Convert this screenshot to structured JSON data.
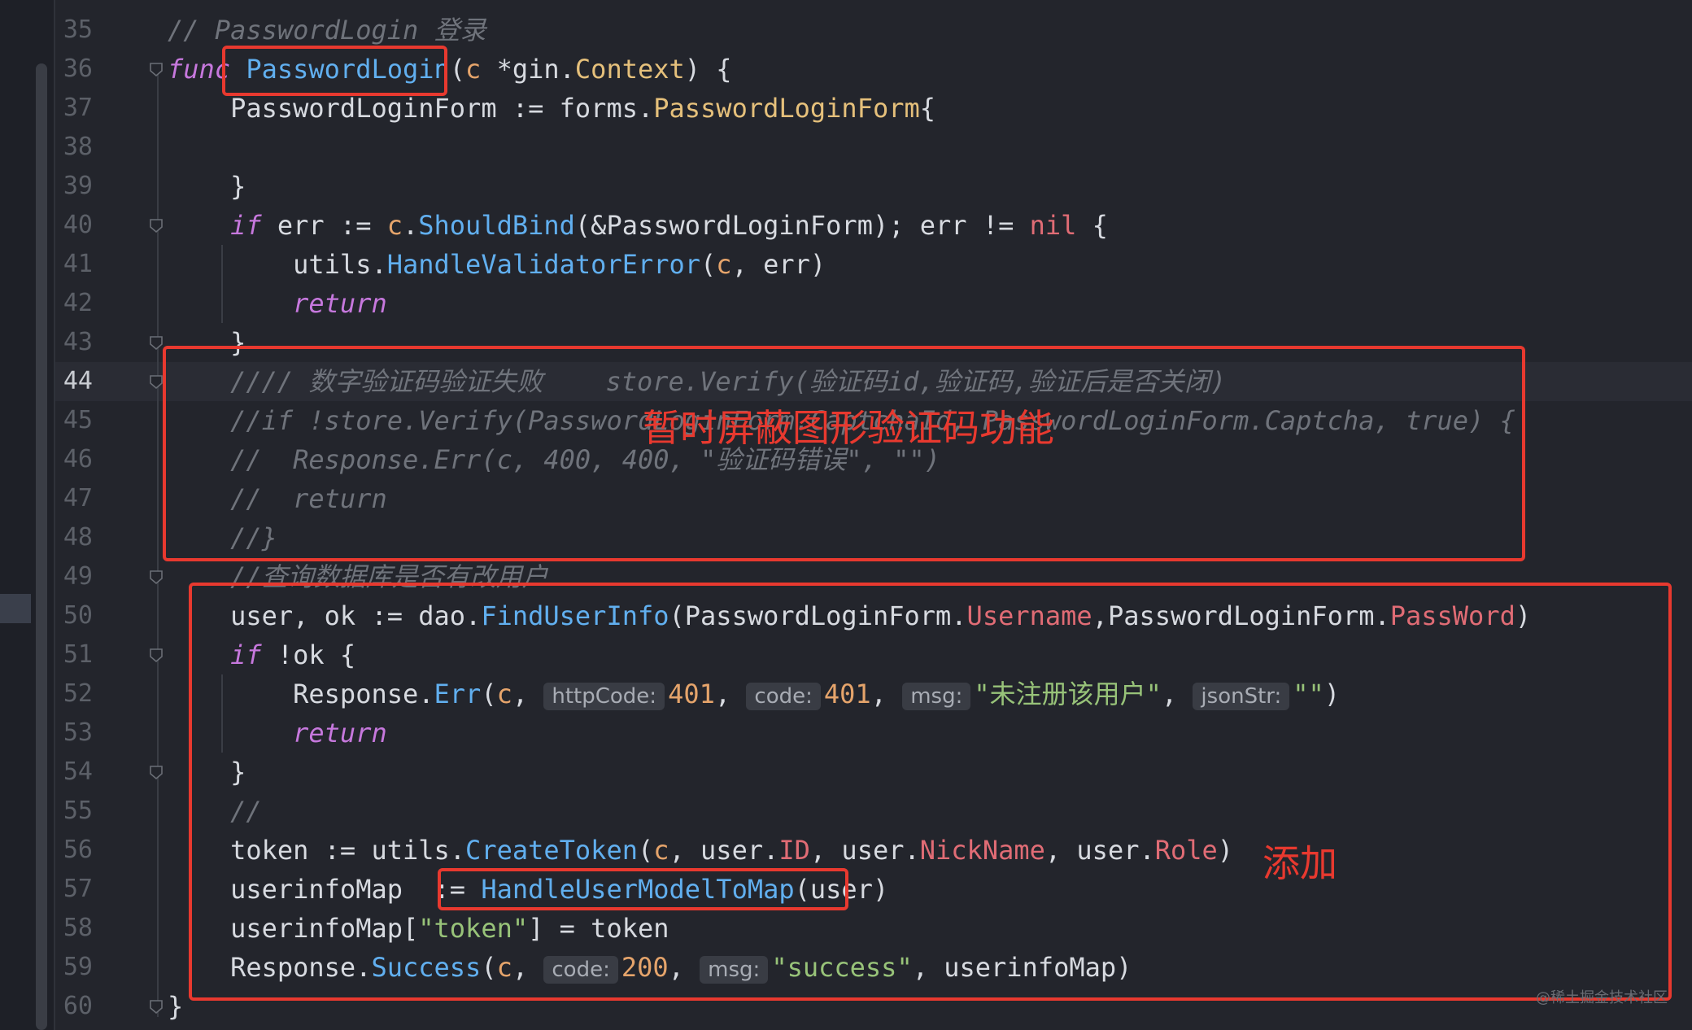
{
  "annotations": {
    "mask_captcha": "暂时屏蔽图形验证码功能",
    "added": "添加"
  },
  "watermark": "@稀土掘金技术社区",
  "colors": {
    "background": "#23252c",
    "annotation_red": "#e8392f",
    "keyword": "#c678dd",
    "function": "#61afef",
    "type": "#e5c07b",
    "field": "#e06c75",
    "string": "#98c379",
    "comment": "#6f737b"
  },
  "lines": [
    {
      "n": "35",
      "fold": false,
      "tokens": [
        {
          "t": "// PasswordLogin 登录",
          "c": "comment"
        }
      ]
    },
    {
      "n": "36",
      "fold": true,
      "tokens": [
        {
          "t": "func ",
          "c": "keyword"
        },
        {
          "t": "PasswordLogin",
          "c": "func"
        },
        {
          "t": "(",
          "c": "punct"
        },
        {
          "t": "c",
          "c": "param"
        },
        {
          "t": " *gin.",
          "c": "plain"
        },
        {
          "t": "Context",
          "c": "type"
        },
        {
          "t": ") {",
          "c": "punct"
        }
      ]
    },
    {
      "n": "37",
      "fold": false,
      "tokens": [
        {
          "t": "    PasswordLoginForm := forms.",
          "c": "plain"
        },
        {
          "t": "PasswordLoginForm",
          "c": "type"
        },
        {
          "t": "{",
          "c": "punct"
        }
      ]
    },
    {
      "n": "38",
      "fold": false,
      "tokens": []
    },
    {
      "n": "39",
      "fold": false,
      "tokens": [
        {
          "t": "    }",
          "c": "punct"
        }
      ]
    },
    {
      "n": "40",
      "fold": true,
      "tokens": [
        {
          "t": "    ",
          "c": "plain"
        },
        {
          "t": "if",
          "c": "keyword"
        },
        {
          "t": " err := ",
          "c": "plain"
        },
        {
          "t": "c",
          "c": "param"
        },
        {
          "t": ".",
          "c": "plain"
        },
        {
          "t": "ShouldBind",
          "c": "func"
        },
        {
          "t": "(&PasswordLoginForm); err != ",
          "c": "plain"
        },
        {
          "t": "nil",
          "c": "nil"
        },
        {
          "t": " {",
          "c": "punct"
        }
      ]
    },
    {
      "n": "41",
      "fold": false,
      "tokens": [
        {
          "t": "        utils.",
          "c": "plain"
        },
        {
          "t": "HandleValidatorError",
          "c": "func"
        },
        {
          "t": "(",
          "c": "punct"
        },
        {
          "t": "c",
          "c": "param"
        },
        {
          "t": ", err)",
          "c": "plain"
        }
      ]
    },
    {
      "n": "42",
      "fold": false,
      "tokens": [
        {
          "t": "        ",
          "c": "plain"
        },
        {
          "t": "return",
          "c": "keyword"
        }
      ]
    },
    {
      "n": "43",
      "fold": true,
      "tokens": [
        {
          "t": "    }",
          "c": "punct"
        }
      ]
    },
    {
      "n": "44",
      "fold": true,
      "active": true,
      "tokens": [
        {
          "t": "    //// 数字验证码验证失败    store.Verify(验证码id,验证码,验证后是否关闭)",
          "c": "comment"
        }
      ]
    },
    {
      "n": "45",
      "fold": false,
      "tokens": [
        {
          "t": "    //if !store.Verify(PasswordLoginForm.CaptchaId, PasswordLoginForm.Captcha, true) {",
          "c": "comment"
        }
      ]
    },
    {
      "n": "46",
      "fold": false,
      "tokens": [
        {
          "t": "    //  Response.Err(c, 400, 400, \"验证码错误\", \"\")",
          "c": "comment"
        }
      ]
    },
    {
      "n": "47",
      "fold": false,
      "tokens": [
        {
          "t": "    //  return",
          "c": "comment"
        }
      ]
    },
    {
      "n": "48",
      "fold": false,
      "tokens": [
        {
          "t": "    //}",
          "c": "comment"
        }
      ]
    },
    {
      "n": "49",
      "fold": true,
      "tokens": [
        {
          "t": "    //查询数据库是否有改用户",
          "c": "comment"
        }
      ]
    },
    {
      "n": "50",
      "fold": false,
      "tokens": [
        {
          "t": "    user, ok := dao.",
          "c": "plain"
        },
        {
          "t": "FindUserInfo",
          "c": "func"
        },
        {
          "t": "(PasswordLoginForm.",
          "c": "plain"
        },
        {
          "t": "Username",
          "c": "field"
        },
        {
          "t": ",PasswordLoginForm.",
          "c": "plain"
        },
        {
          "t": "PassWord",
          "c": "field"
        },
        {
          "t": ")",
          "c": "punct"
        }
      ]
    },
    {
      "n": "51",
      "fold": true,
      "tokens": [
        {
          "t": "    ",
          "c": "plain"
        },
        {
          "t": "if",
          "c": "keyword"
        },
        {
          "t": " !ok {",
          "c": "plain"
        }
      ]
    },
    {
      "n": "52",
      "fold": false,
      "tokens": [
        {
          "t": "        Response.",
          "c": "plain"
        },
        {
          "t": "Err",
          "c": "func"
        },
        {
          "t": "(",
          "c": "punct"
        },
        {
          "t": "c",
          "c": "param"
        },
        {
          "t": ", ",
          "c": "plain"
        },
        {
          "t": "httpCode:",
          "c": "hint"
        },
        {
          "t": "401",
          "c": "num"
        },
        {
          "t": ", ",
          "c": "plain"
        },
        {
          "t": "code:",
          "c": "hint"
        },
        {
          "t": "401",
          "c": "num"
        },
        {
          "t": ", ",
          "c": "plain"
        },
        {
          "t": "msg:",
          "c": "hint"
        },
        {
          "t": "\"未注册该用户\"",
          "c": "string"
        },
        {
          "t": ", ",
          "c": "plain"
        },
        {
          "t": "jsonStr:",
          "c": "hint"
        },
        {
          "t": "\"\"",
          "c": "string"
        },
        {
          "t": ")",
          "c": "punct"
        }
      ]
    },
    {
      "n": "53",
      "fold": false,
      "tokens": [
        {
          "t": "        ",
          "c": "plain"
        },
        {
          "t": "return",
          "c": "keyword"
        }
      ]
    },
    {
      "n": "54",
      "fold": true,
      "tokens": [
        {
          "t": "    }",
          "c": "punct"
        }
      ]
    },
    {
      "n": "55",
      "fold": false,
      "tokens": [
        {
          "t": "    //",
          "c": "comment"
        }
      ]
    },
    {
      "n": "56",
      "fold": false,
      "tokens": [
        {
          "t": "    token := utils.",
          "c": "plain"
        },
        {
          "t": "CreateToken",
          "c": "func"
        },
        {
          "t": "(",
          "c": "punct"
        },
        {
          "t": "c",
          "c": "param"
        },
        {
          "t": ", user.",
          "c": "plain"
        },
        {
          "t": "ID",
          "c": "field"
        },
        {
          "t": ", user.",
          "c": "plain"
        },
        {
          "t": "NickName",
          "c": "field"
        },
        {
          "t": ", user.",
          "c": "plain"
        },
        {
          "t": "Role",
          "c": "field"
        },
        {
          "t": ")",
          "c": "punct"
        }
      ]
    },
    {
      "n": "57",
      "fold": false,
      "tokens": [
        {
          "t": "    userinfoMap  := ",
          "c": "plain"
        },
        {
          "t": "HandleUserModelToMap",
          "c": "func"
        },
        {
          "t": "(user)",
          "c": "plain"
        }
      ]
    },
    {
      "n": "58",
      "fold": false,
      "tokens": [
        {
          "t": "    userinfoMap[",
          "c": "plain"
        },
        {
          "t": "\"token\"",
          "c": "string"
        },
        {
          "t": "] = token",
          "c": "plain"
        }
      ]
    },
    {
      "n": "59",
      "fold": false,
      "tokens": [
        {
          "t": "    Response.",
          "c": "plain"
        },
        {
          "t": "Success",
          "c": "func"
        },
        {
          "t": "(",
          "c": "punct"
        },
        {
          "t": "c",
          "c": "param"
        },
        {
          "t": ", ",
          "c": "plain"
        },
        {
          "t": "code:",
          "c": "hint"
        },
        {
          "t": "200",
          "c": "num"
        },
        {
          "t": ", ",
          "c": "plain"
        },
        {
          "t": "msg:",
          "c": "hint"
        },
        {
          "t": "\"success\"",
          "c": "string"
        },
        {
          "t": ", userinfoMap)",
          "c": "plain"
        }
      ]
    },
    {
      "n": "60",
      "fold": true,
      "tokens": [
        {
          "t": "}",
          "c": "punct"
        }
      ]
    }
  ]
}
